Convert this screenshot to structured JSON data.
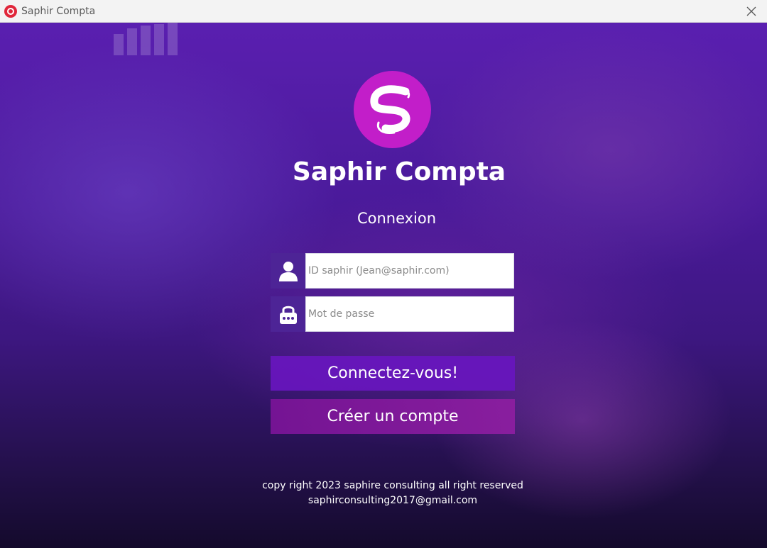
{
  "window": {
    "title": "Saphir Compta"
  },
  "icons": {
    "app": "app-icon",
    "close": "close-icon",
    "logo": "saphir-logo-icon",
    "user": "user-icon",
    "lock": "lock-icon"
  },
  "colors": {
    "logo_circle": "#c21ec9",
    "login_button": "#6816be",
    "create_button": "#841896",
    "field_icon_bg": "#4d2496"
  },
  "main": {
    "app_title": "Saphir Compta",
    "subtitle": "Connexion",
    "id_field": {
      "placeholder": "ID saphir  (Jean@saphir.com)",
      "value": ""
    },
    "password_field": {
      "placeholder": "Mot de passe",
      "value": ""
    },
    "login_button": "Connectez-vous!",
    "create_account_button": "Créer un compte"
  },
  "footer": {
    "copyright": "copy right 2023 saphire consulting all right reserved",
    "email": "saphirconsulting2017@gmail.com"
  }
}
